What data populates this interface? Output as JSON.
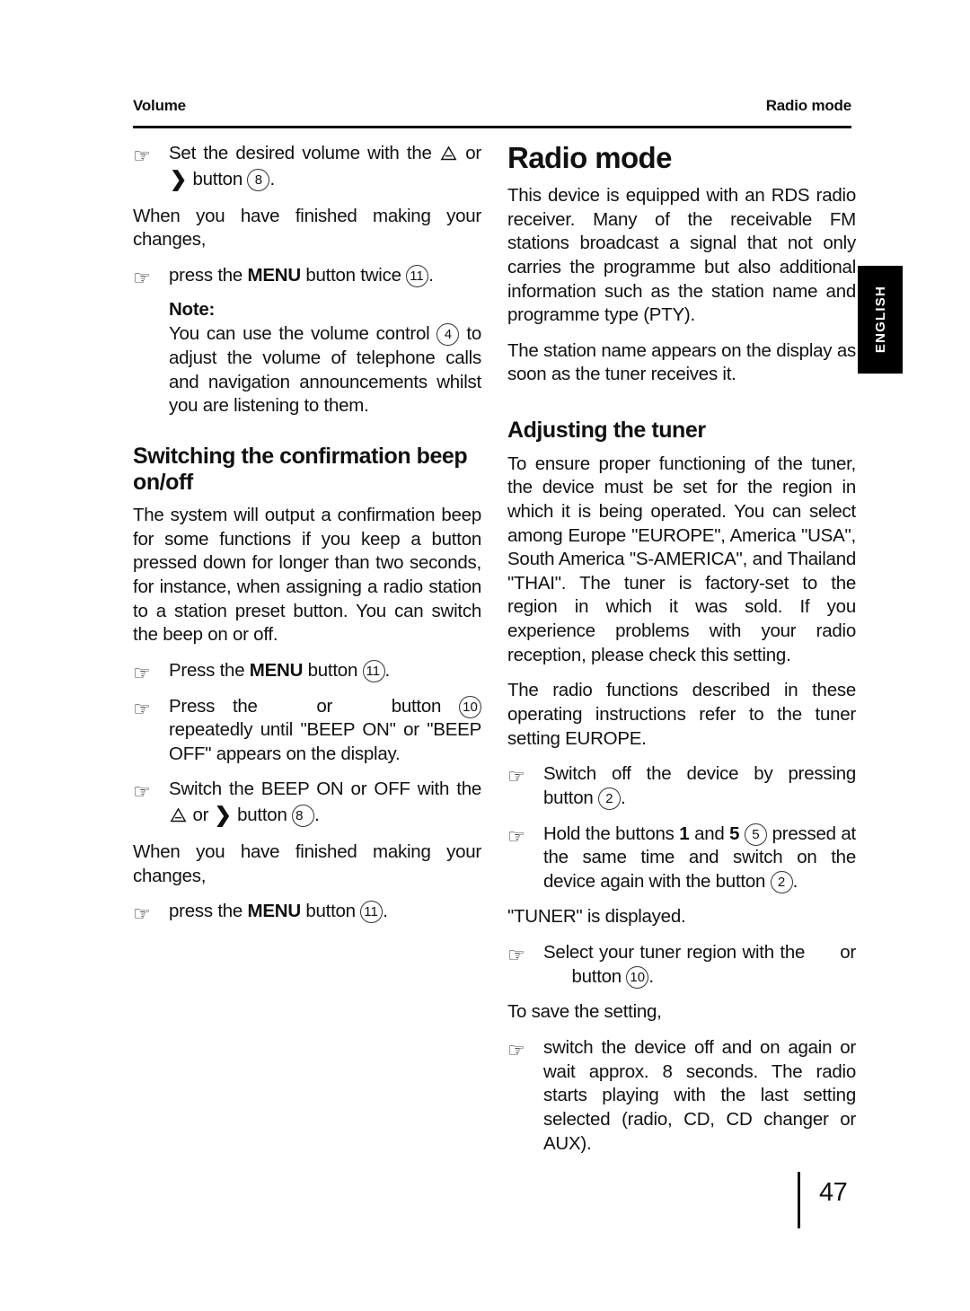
{
  "header": {
    "left": "Volume",
    "right": "Radio mode"
  },
  "side_tab": {
    "label": "ENGLISH"
  },
  "footer": {
    "page_number": "47"
  },
  "icons": {
    "bullet": "pointing-hand-icon",
    "warning_triangle": "warning-triangle-icon",
    "chevron_right": "chevron-right-icon"
  },
  "left_column": {
    "b1_pre": "Set the desired volume with the ",
    "b1_mid": " or ",
    "b1_post": "button ",
    "b1_badge": "8",
    "b1_end": ".",
    "p1": "When you have finished making your changes,",
    "b2_pre": "press the ",
    "b2_bold": "MENU",
    "b2_post": " button twice ",
    "b2_badge": "11",
    "b2_end": ".",
    "note_title": "Note:",
    "note_pre": "You can use the volume control ",
    "note_badge": "4",
    "note_post": " to adjust the volume of telephone calls and navigation announcements whilst you are listening to them.",
    "heading": "Switching the confirmation beep on/off",
    "p2": "The system will output a confirmation beep for some functions if you keep a button pressed down for longer than two seconds, for instance, when assigning a radio station to a station preset button. You can switch the beep on or off.",
    "b3_pre": "Press the ",
    "b3_bold": "MENU",
    "b3_post": " button ",
    "b3_badge": "11",
    "b3_end": ".",
    "b4_pre": "Press the",
    "b4_mid": "or",
    "b4_post": "button ",
    "b4_badge": "10",
    "b4_end": " repeatedly until \"BEEP ON\" or \"BEEP OFF\" appears on the display.",
    "b5_pre": "Switch the BEEP ON or OFF with the ",
    "b5_mid": " or ",
    "b5_post": "button ",
    "b5_badge": "8",
    "b5_end": ".",
    "p3": "When you have finished making your changes,",
    "b6_pre": "press the ",
    "b6_bold": "MENU",
    "b6_post": " button ",
    "b6_badge": "11",
    "b6_end": "."
  },
  "right_column": {
    "chapter_title": "Radio mode",
    "p1": "This device is equipped with an RDS radio receiver. Many of the receivable FM stations broadcast a signal that not only carries the programme but also additional information such as the station name and programme type (PTY).",
    "p2": "The station name appears on the display as soon as the tuner receives it.",
    "heading": "Adjusting the tuner",
    "p3": "To ensure proper functioning of the tuner, the device must be set for the region in which it is being operated. You can select among Europe \"EUROPE\", America \"USA\", South America \"S-AMERICA\", and Thailand \"THAI\". The tuner is factory-set to the region in which it was sold. If you experience problems with your radio reception, please check this setting.",
    "p4": "The radio functions described in these operating instructions refer to the tuner setting EUROPE.",
    "b1_pre": "Switch off the device by pressing button ",
    "b1_badge": "2",
    "b1_end": ".",
    "b2_pre": "Hold the buttons ",
    "b2_bold1": "1",
    "b2_mid": " and ",
    "b2_bold2": "5",
    "b2_badge1": "5",
    "b2_post": " pressed at the same time and switch on the device again with the button ",
    "b2_badge2": "2",
    "b2_end": ".",
    "p5": "\"TUNER\" is displayed.",
    "b3_pre": "Select your tuner region with the",
    "b3_mid": "or",
    "b3_post": "button ",
    "b3_badge": "10",
    "b3_end": ".",
    "p6": "To save the setting,",
    "b4": "switch the device off and on again or wait approx. 8 seconds. The radio starts playing with the last setting selected (radio, CD, CD changer or AUX)."
  }
}
